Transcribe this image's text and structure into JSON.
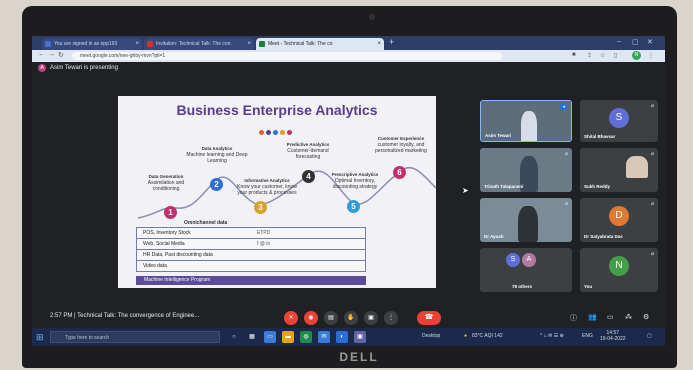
{
  "browser": {
    "tabs": [
      {
        "label": "You are signed in as epp193"
      },
      {
        "label": "Invitation: Technical Talk: The con"
      },
      {
        "label": "Meet - Technical Talk: The co"
      }
    ],
    "new_tab": "+",
    "url": "meet.google.com/nee-ghby-mvn?pli=1"
  },
  "meet": {
    "presenter_initial": "A",
    "presenter_text": "Asim Tewari is presenting",
    "time": "2:57 PM",
    "meeting_title": "Technical Talk: The convergence of Enginee..."
  },
  "slide": {
    "title": "Business Enterprise Analytics",
    "dot_colors": [
      "#e35d2e",
      "#5a3c8c",
      "#2f6ed8",
      "#d9a22a",
      "#c0306e"
    ],
    "steps": [
      {
        "num": "1",
        "color": "#c0306e",
        "label": "Data Generation",
        "desc": "Assimilation and conditioning"
      },
      {
        "num": "2",
        "color": "#2f6ed8",
        "label": "Data Analytics",
        "desc": "Machine learning and Deep Learning"
      },
      {
        "num": "3",
        "color": "#d9a22a",
        "label": "Informative Analytics",
        "desc": "Know your customer, know your products & processes"
      },
      {
        "num": "4",
        "color": "#333333",
        "label": "Predictive Analytics",
        "desc": "Customer-demand forecasting"
      },
      {
        "num": "5",
        "color": "#2f9ed8",
        "label": "Prescriptive Analytics",
        "desc": "Optimal Inventory, discounting strategy"
      },
      {
        "num": "6",
        "color": "#c0306e",
        "label": "Customer Experience",
        "desc": "customer loyalty, and personalized marketing"
      }
    ],
    "omni_label": "Omnichannel data",
    "rows": [
      {
        "text": "POS, Inventory Stock",
        "right": "ETPD"
      },
      {
        "text": "Web, Social Media",
        "right": "f @ in"
      },
      {
        "text": "HR Data, Past discounting data",
        "right": ""
      },
      {
        "text": "Video data",
        "right": ""
      }
    ],
    "banner": "Machine Intelligence Program"
  },
  "participants": [
    {
      "name": "Asim Tewari",
      "type": "video"
    },
    {
      "name": "Shital Bhavsar",
      "initial": "S",
      "color": "#5f6ed8"
    },
    {
      "name": "Trinath Talapaneni",
      "type": "video"
    },
    {
      "name": "Sukh Reddy",
      "type": "video"
    },
    {
      "name": "Dr Ayush",
      "type": "video"
    },
    {
      "name": "Dr Satyabrata Das",
      "initial": "D",
      "color": "#e07a2e"
    },
    {
      "name": "78 others",
      "initials": [
        "S",
        "A"
      ],
      "colors": [
        "#5f6ed8",
        "#b07aa1"
      ]
    },
    {
      "name": "You",
      "initial": "N",
      "color": "#43a047"
    }
  ],
  "taskbar": {
    "search_placeholder": "Type here to search",
    "desktop_label": "Desktop",
    "weather": "83°C AQI 142",
    "lang": "ENG",
    "clock_time": "14:57",
    "clock_date": "19-04-2022"
  }
}
